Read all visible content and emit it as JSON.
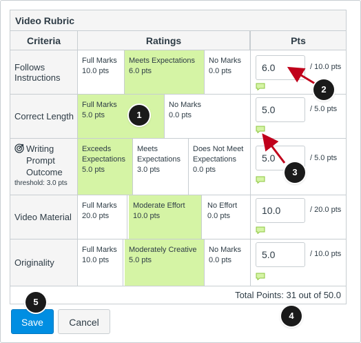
{
  "rubric_title": "Video Rubric",
  "headers": {
    "criteria": "Criteria",
    "ratings": "Ratings",
    "pts": "Pts"
  },
  "rows": [
    {
      "criteria": "Follows Instructions",
      "ratings": [
        {
          "label": "Full Marks",
          "pts": "10.0 pts",
          "selected": false
        },
        {
          "label": "Meets Expectations",
          "pts": "6.0 pts",
          "selected": true
        },
        {
          "label": "No Marks",
          "pts": "0.0 pts",
          "selected": false
        }
      ],
      "score": "6.0",
      "max": "/ 10.0 pts"
    },
    {
      "criteria": "Correct Length",
      "ratings": [
        {
          "label": "Full Marks",
          "pts": "5.0 pts",
          "selected": true
        },
        {
          "label": "No Marks",
          "pts": "0.0 pts",
          "selected": false
        }
      ],
      "score": "5.0",
      "max": "/ 5.0 pts"
    },
    {
      "criteria": "Writing Prompt Outcome",
      "threshold": "threshold: 3.0 pts",
      "icon": "target-icon",
      "ratings": [
        {
          "label": "Exceeds Expectations",
          "pts": "5.0 pts",
          "selected": true
        },
        {
          "label": "Meets Expectations",
          "pts": "3.0 pts",
          "selected": false
        },
        {
          "label": "Does Not Meet Expectations",
          "pts": "0.0 pts",
          "selected": false
        }
      ],
      "score": "5.0",
      "max": "/ 5.0 pts"
    },
    {
      "criteria": "Video Material",
      "ratings": [
        {
          "label": "Full Marks",
          "pts": "20.0 pts",
          "selected": false
        },
        {
          "label": "Moderate Effort",
          "pts": "10.0 pts",
          "selected": true
        },
        {
          "label": "No Effort",
          "pts": "0.0 pts",
          "selected": false
        }
      ],
      "score": "10.0",
      "max": "/ 20.0 pts"
    },
    {
      "criteria": "Originality",
      "ratings": [
        {
          "label": "Full Marks",
          "pts": "10.0 pts",
          "selected": false
        },
        {
          "label": "Moderately Creative",
          "pts": "5.0 pts",
          "selected": true
        },
        {
          "label": "No Marks",
          "pts": "0.0 pts",
          "selected": false
        }
      ],
      "score": "5.0",
      "max": "/ 10.0 pts"
    }
  ],
  "total": "Total Points: 31 out of 50.0",
  "buttons": {
    "save": "Save",
    "cancel": "Cancel"
  },
  "callouts": [
    "1",
    "2",
    "3",
    "4",
    "5"
  ],
  "colors": {
    "selected": "#d5f4a5",
    "primary": "#008ee2",
    "arrow": "#c0001b",
    "comment": "#d5f4a5"
  }
}
